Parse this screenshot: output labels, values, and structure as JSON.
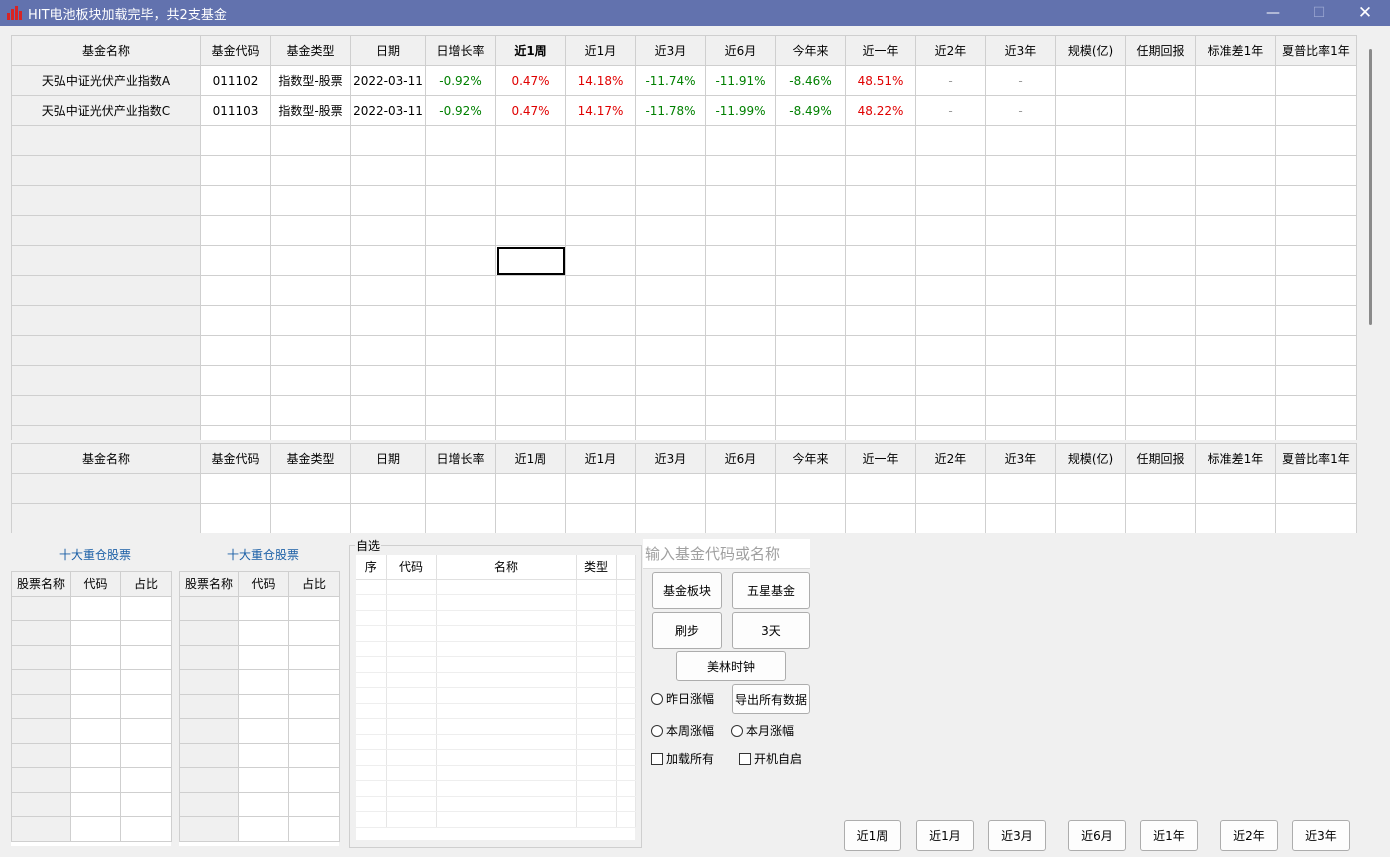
{
  "window": {
    "title": "HIT电池板块加载完毕，共2支基金",
    "min_glyph": "—",
    "max_glyph": "☐",
    "close_glyph": "✕"
  },
  "fund_table": {
    "columns": [
      "基金名称",
      "基金代码",
      "基金类型",
      "日期",
      "日增长率",
      "近1周",
      "近1月",
      "近3月",
      "近6月",
      "今年来",
      "近一年",
      "近2年",
      "近3年",
      "规模(亿)",
      "任期回报",
      "标准差1年",
      "夏普比率1年"
    ],
    "rows": [
      {
        "name": "天弘中证光伏产业指数A",
        "code": "011102",
        "type": "指数型-股票",
        "date": "2022-03-11",
        "day": "-0.92%",
        "w1": "0.47%",
        "m1": "14.18%",
        "m3": "-11.74%",
        "m6": "-11.91%",
        "ytd": "-8.46%",
        "y1": "48.51%",
        "y2": "-",
        "y3": "-",
        "scale": "",
        "tenure": "",
        "std1": "",
        "sharpe1": ""
      },
      {
        "name": "天弘中证光伏产业指数C",
        "code": "011103",
        "type": "指数型-股票",
        "date": "2022-03-11",
        "day": "-0.92%",
        "w1": "0.47%",
        "m1": "14.17%",
        "m3": "-11.78%",
        "m6": "-11.99%",
        "ytd": "-8.49%",
        "y1": "48.22%",
        "y2": "-",
        "y3": "-",
        "scale": "",
        "tenure": "",
        "std1": "",
        "sharpe1": ""
      }
    ]
  },
  "compare_table": {
    "columns": [
      "基金名称",
      "基金代码",
      "基金类型",
      "日期",
      "日增长率",
      "近1周",
      "近1月",
      "近3月",
      "近6月",
      "今年来",
      "近一年",
      "近2年",
      "近3年",
      "规模(亿)",
      "任期回报",
      "标准差1年",
      "夏普比率1年"
    ]
  },
  "holdings": {
    "title": "十大重仓股票",
    "columns": [
      "股票名称",
      "代码",
      "占比"
    ]
  },
  "watchlist": {
    "group_label": "自选",
    "columns": [
      "序",
      "代码",
      "名称",
      "类型"
    ]
  },
  "controls": {
    "search_placeholder": "输入基金代码或名称",
    "fund_sector": "基金板块",
    "five_star": "五星基金",
    "refresh": "刷步",
    "three_days": "3天",
    "merrill_clock": "美林时钟",
    "export_all": "导出所有数据",
    "yesterday_change": "昨日涨幅",
    "week_change": "本周涨幅",
    "month_change": "本月涨幅",
    "load_all": "加载所有",
    "autostart": "开机自启"
  },
  "period_buttons": [
    "近1周",
    "近1月",
    "近3月",
    "近6月",
    "近1年",
    "近2年",
    "近3年"
  ],
  "colors": {
    "titlebar": "#6272ae",
    "positive": "#e00000",
    "negative": "#008000",
    "link": "#1b5fa6"
  }
}
